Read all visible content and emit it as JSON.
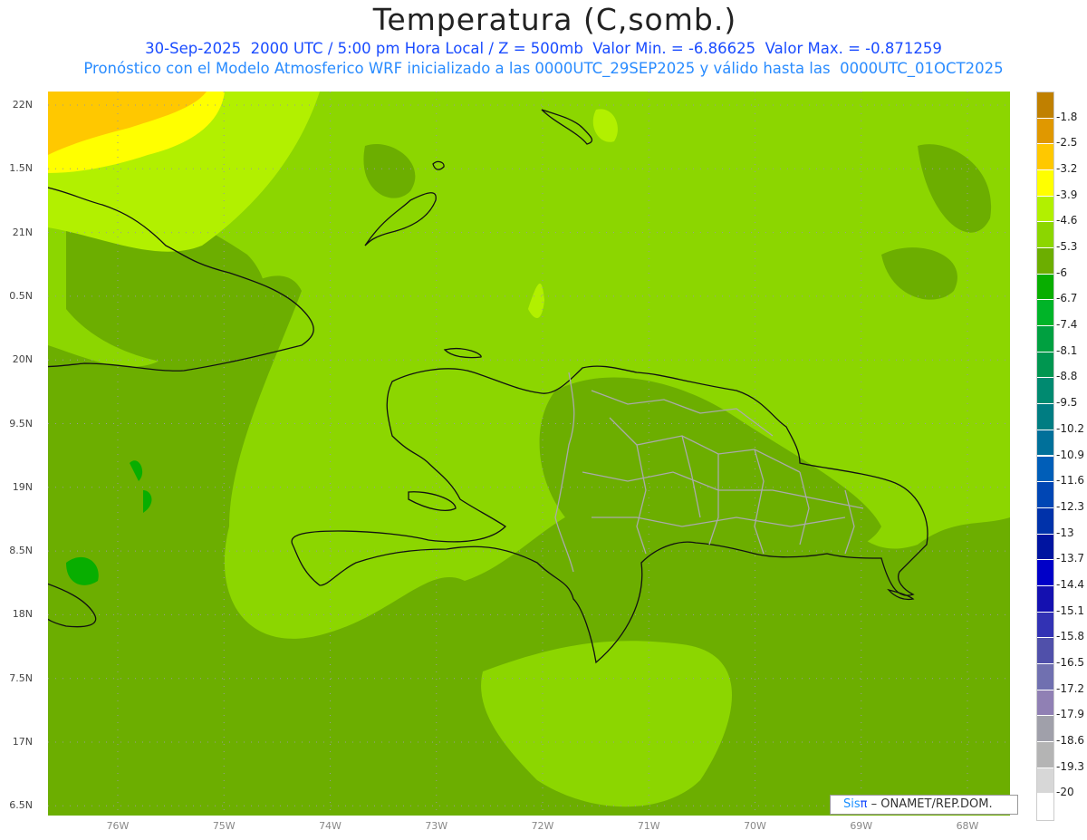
{
  "header": {
    "title": "Temperatura (C,somb.)",
    "subtitle1": "30-Sep-2025  2000 UTC / 5:00 pm Hora Local / Z = 500mb  Valor Min. = -6.86625  Valor Max. = -0.871259",
    "subtitle2": "Pronóstico con el Modelo Atmosferico WRF inicializado a las 0000UTC_29SEP2025 y válido hasta las  0000UTC_01OCT2025"
  },
  "map": {
    "lat_labels": [
      "22N",
      "1.5N",
      "21N",
      "0.5N",
      "20N",
      "9.5N",
      "19N",
      "8.5N",
      "18N",
      "7.5N",
      "17N",
      "6.5N"
    ],
    "lon_labels": [
      "76W",
      "75W",
      "74W",
      "73W",
      "72W",
      "71W",
      "70W",
      "69W",
      "68W"
    ],
    "colors": {
      "base": "#8cd600",
      "dark": "#6cae00",
      "light": "#b2f000",
      "yellow": "#ffff00",
      "orange": "#ffc800",
      "coast": "#111111",
      "border": "#aaaaaa"
    }
  },
  "colorbar": {
    "labels": [
      "-1.8",
      "-2.5",
      "-3.2",
      "-3.9",
      "-4.6",
      "-5.3",
      "-6",
      "-6.7",
      "-7.4",
      "-8.1",
      "-8.8",
      "-9.5",
      "-10.2",
      "-10.9",
      "-11.6",
      "-12.3",
      "-13",
      "-13.7",
      "-14.4",
      "-15.1",
      "-15.8",
      "-16.5",
      "-17.2",
      "-17.9",
      "-18.6",
      "-19.3",
      "-20"
    ],
    "colors": [
      "#c08000",
      "#e09800",
      "#ffc800",
      "#ffff00",
      "#b2f000",
      "#8cd600",
      "#6cae00",
      "#08ae00",
      "#00b428",
      "#00a040",
      "#009650",
      "#008a70",
      "#007d82",
      "#00709a",
      "#005eb8",
      "#0046b4",
      "#0032aa",
      "#0014a0",
      "#0000c8",
      "#1410b0",
      "#3232b4",
      "#5050aa",
      "#7070b0",
      "#9080b4",
      "#a0a0aa",
      "#b4b4b4",
      "#d7d7d7",
      "#ffffff"
    ]
  },
  "credit": {
    "brand": "Sis",
    "pi": "π",
    "text": "– ONAMET/REP.DOM."
  }
}
